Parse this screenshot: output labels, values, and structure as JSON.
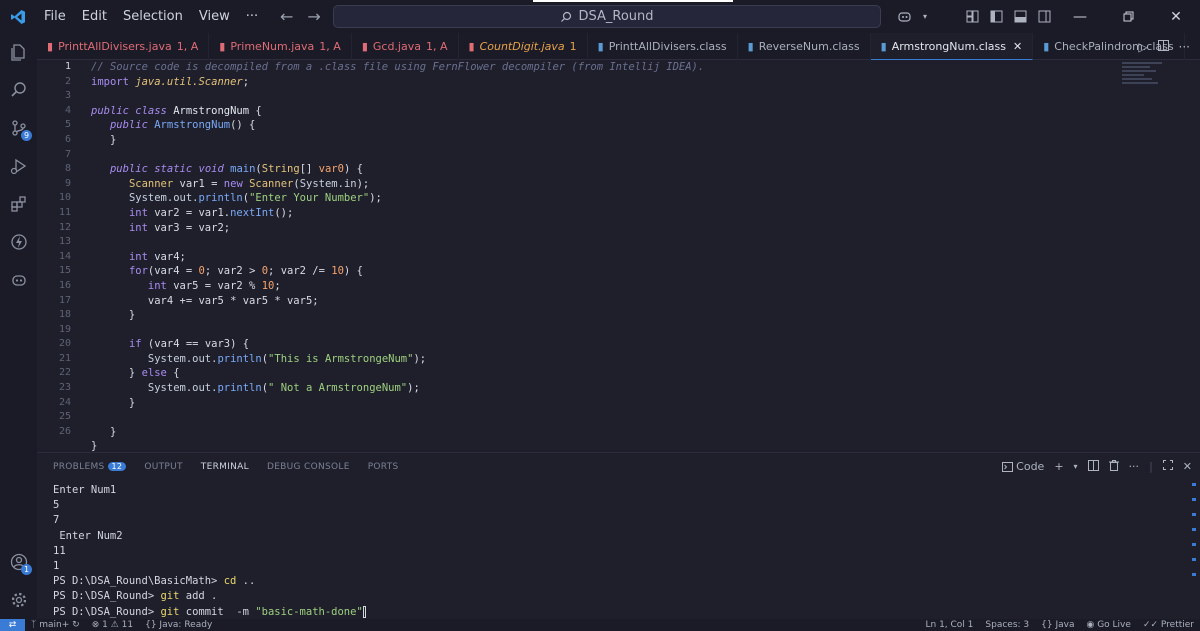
{
  "titlebar": {
    "menu": [
      "File",
      "Edit",
      "Selection",
      "View",
      "···"
    ],
    "search_text": "DSA_Round"
  },
  "activity": {
    "scm_badge": "9",
    "accounts_badge": "1"
  },
  "tabs": [
    {
      "label": "PrinttAllDivisers.java",
      "suffix": "1, A",
      "state": "error"
    },
    {
      "label": "PrimeNum.java",
      "suffix": "1, A",
      "state": "error"
    },
    {
      "label": "Gcd.java",
      "suffix": "1, A",
      "state": "error"
    },
    {
      "label": "CountDigit.java",
      "suffix": "1",
      "state": "modified"
    },
    {
      "label": "PrinttAllDivisers.class",
      "suffix": "",
      "state": "normal"
    },
    {
      "label": "ReverseNum.class",
      "suffix": "",
      "state": "normal"
    },
    {
      "label": "ArmstrongNum.class",
      "suffix": "",
      "state": "active"
    },
    {
      "label": "CheckPalindrom.class",
      "suffix": "",
      "state": "normal"
    }
  ],
  "editor": {
    "line_numbers": [
      "1",
      "2",
      "3",
      "4",
      "5",
      "6",
      "7",
      "8",
      "9",
      "10",
      "11",
      "12",
      "13",
      "14",
      "15",
      "16",
      "17",
      "18",
      "19",
      "20",
      "21",
      "22",
      "23",
      "24",
      "25",
      "26"
    ],
    "current_line": 1
  },
  "code": {
    "l1_comment": "// Source code is decompiled from a .class file using FernFlower decompiler (from Intellij IDEA).",
    "l2_import": "import",
    "l2_pkg": "java.util.Scanner",
    "l4_public": "public",
    "l4_class": "class",
    "l4_name": "ArmstrongNum",
    "l5_ctor": "ArmstrongNum",
    "l8_static": "static",
    "l8_void": "void",
    "l8_main": "main",
    "l8_string": "String",
    "l8_arg": "var0",
    "l9_scanner": "Scanner",
    "l9_var": "var1",
    "l9_new": "new",
    "l9_systemin": "System.in",
    "l10_out": "System.out.",
    "l10_println": "println",
    "l10_str": "\"Enter Your Number\"",
    "l11_int": "int",
    "l11_rest": "var2 = var1.",
    "l11_nextint": "nextInt",
    "l12_rest": "var3 = var2;",
    "l14_rest": "var4;",
    "l15_for": "for",
    "l15_a": "(var4 = ",
    "l15_b": "; var2 > ",
    "l15_c": "; var2 /= ",
    "l15_d": ") {",
    "l15_zero": "0",
    "l15_ten": "10",
    "l16_rest": "var5 = var2 % ",
    "l17_rest": "var4 += var5 * var5 * var5;",
    "l20_if": "if",
    "l20_rest": "(var4 == var3) {",
    "l21_str": "\"This is ArmstrongeNum\"",
    "l22_else": "else",
    "l23_str": "\" Not a ArmstrongeNum\""
  },
  "panel": {
    "tabs": [
      "PROBLEMS",
      "OUTPUT",
      "TERMINAL",
      "DEBUG CONSOLE",
      "PORTS"
    ],
    "problems_count": "12",
    "shell_label": "Code"
  },
  "terminal": {
    "lines": [
      "Enter Num1",
      "5",
      "7",
      " Enter Num2",
      "11",
      "1"
    ],
    "p1_prompt": "PS D:\\DSA_Round\\BasicMath> ",
    "p1_cmd": "cd",
    "p1_arg": " ..",
    "p2_prompt": "PS D:\\DSA_Round> ",
    "p2_cmd": "git",
    "p2_arg": " add .",
    "p3_prompt": "PS D:\\DSA_Round> ",
    "p3_cmd": "git",
    "p3_arg": " commit  -m ",
    "p3_msg": "\"basic-math-done\""
  },
  "statusbar": {
    "branch": "main+",
    "errors": "1",
    "warnings": "11",
    "java": "Java: Ready",
    "position": "Ln 1, Col 1",
    "spaces": "Spaces: 3",
    "language": "Java",
    "golive": "Go Live",
    "prettier": "Prettier"
  },
  "colors": {
    "accent": "#3a7bd5",
    "background": "#1e1f2b",
    "error": "#e06c75"
  }
}
